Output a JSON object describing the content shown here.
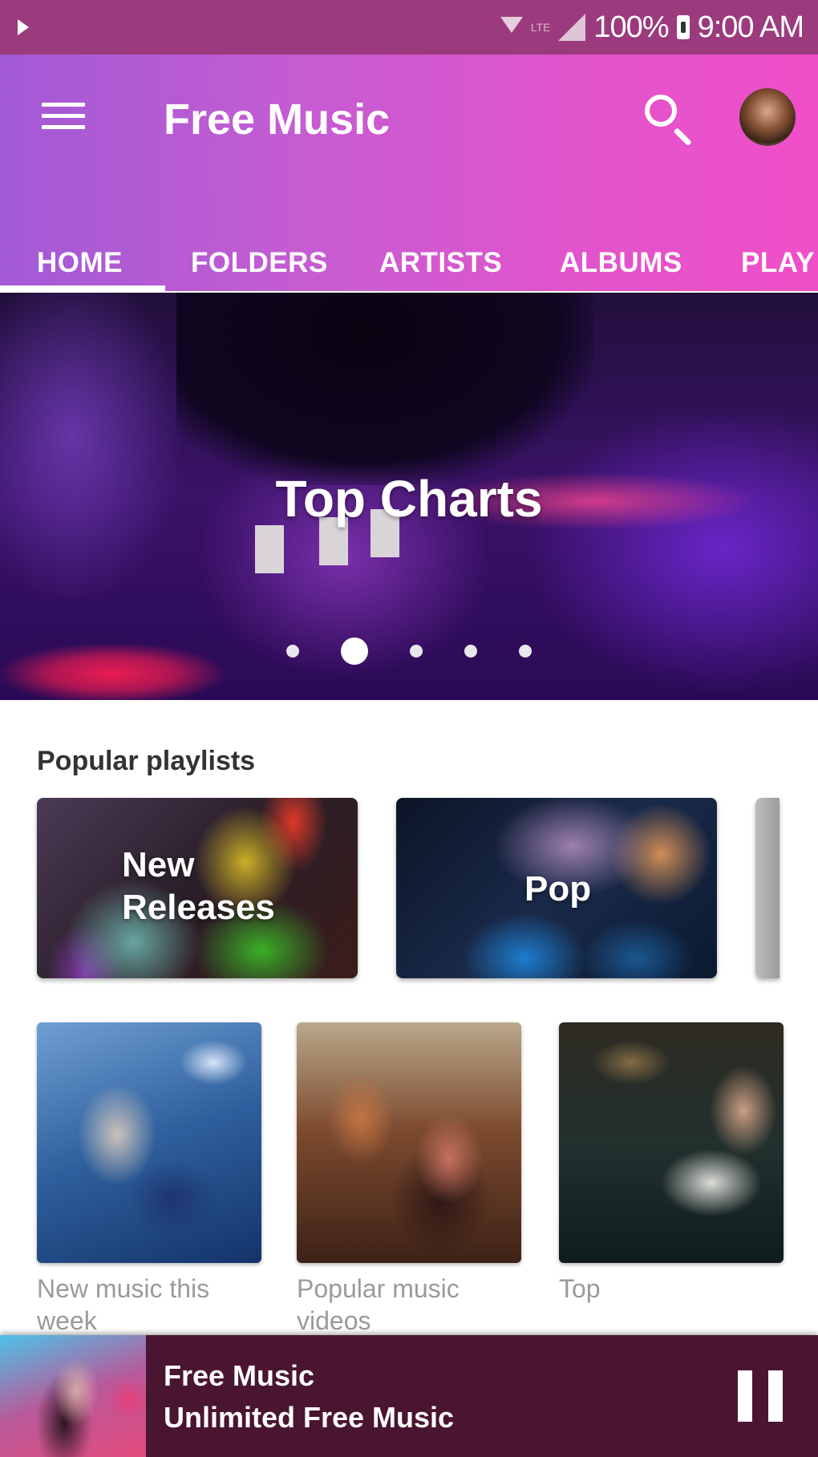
{
  "status_bar": {
    "battery": "100%",
    "time": "9:00 AM",
    "network_label": "LTE",
    "icons": [
      "play-icon",
      "wifi-icon",
      "signal-icon",
      "battery-icon"
    ]
  },
  "app_bar": {
    "title": "Free Music",
    "menu_icon": "hamburger-menu-icon",
    "search_icon": "search-icon",
    "avatar": "user-avatar",
    "gradient_start": "#a25ad6",
    "gradient_end": "#f04fc8"
  },
  "tabs": [
    {
      "label": "HOME",
      "active": true
    },
    {
      "label": "FOLDERS",
      "active": false
    },
    {
      "label": "ARTISTS",
      "active": false
    },
    {
      "label": "ALBUMS",
      "active": false
    },
    {
      "label": "PLAY",
      "active": false
    }
  ],
  "hero": {
    "title": "Top Charts",
    "slide_count": 5,
    "active_slide": 2
  },
  "popular_playlists": {
    "title": "Popular playlists",
    "items": [
      {
        "label": "New\nReleases",
        "label_line1": "New",
        "label_line2": "Releases"
      },
      {
        "label": "Pop"
      },
      {
        "label": ""
      }
    ]
  },
  "videos": [
    {
      "caption": "New music this week"
    },
    {
      "caption": "Popular music videos"
    },
    {
      "caption": "Top"
    }
  ],
  "now_playing": {
    "title": "Free Music",
    "subtitle": "Unlimited Free Music",
    "state": "playing",
    "control_icon": "pause-icon",
    "background": "#4a1530"
  }
}
